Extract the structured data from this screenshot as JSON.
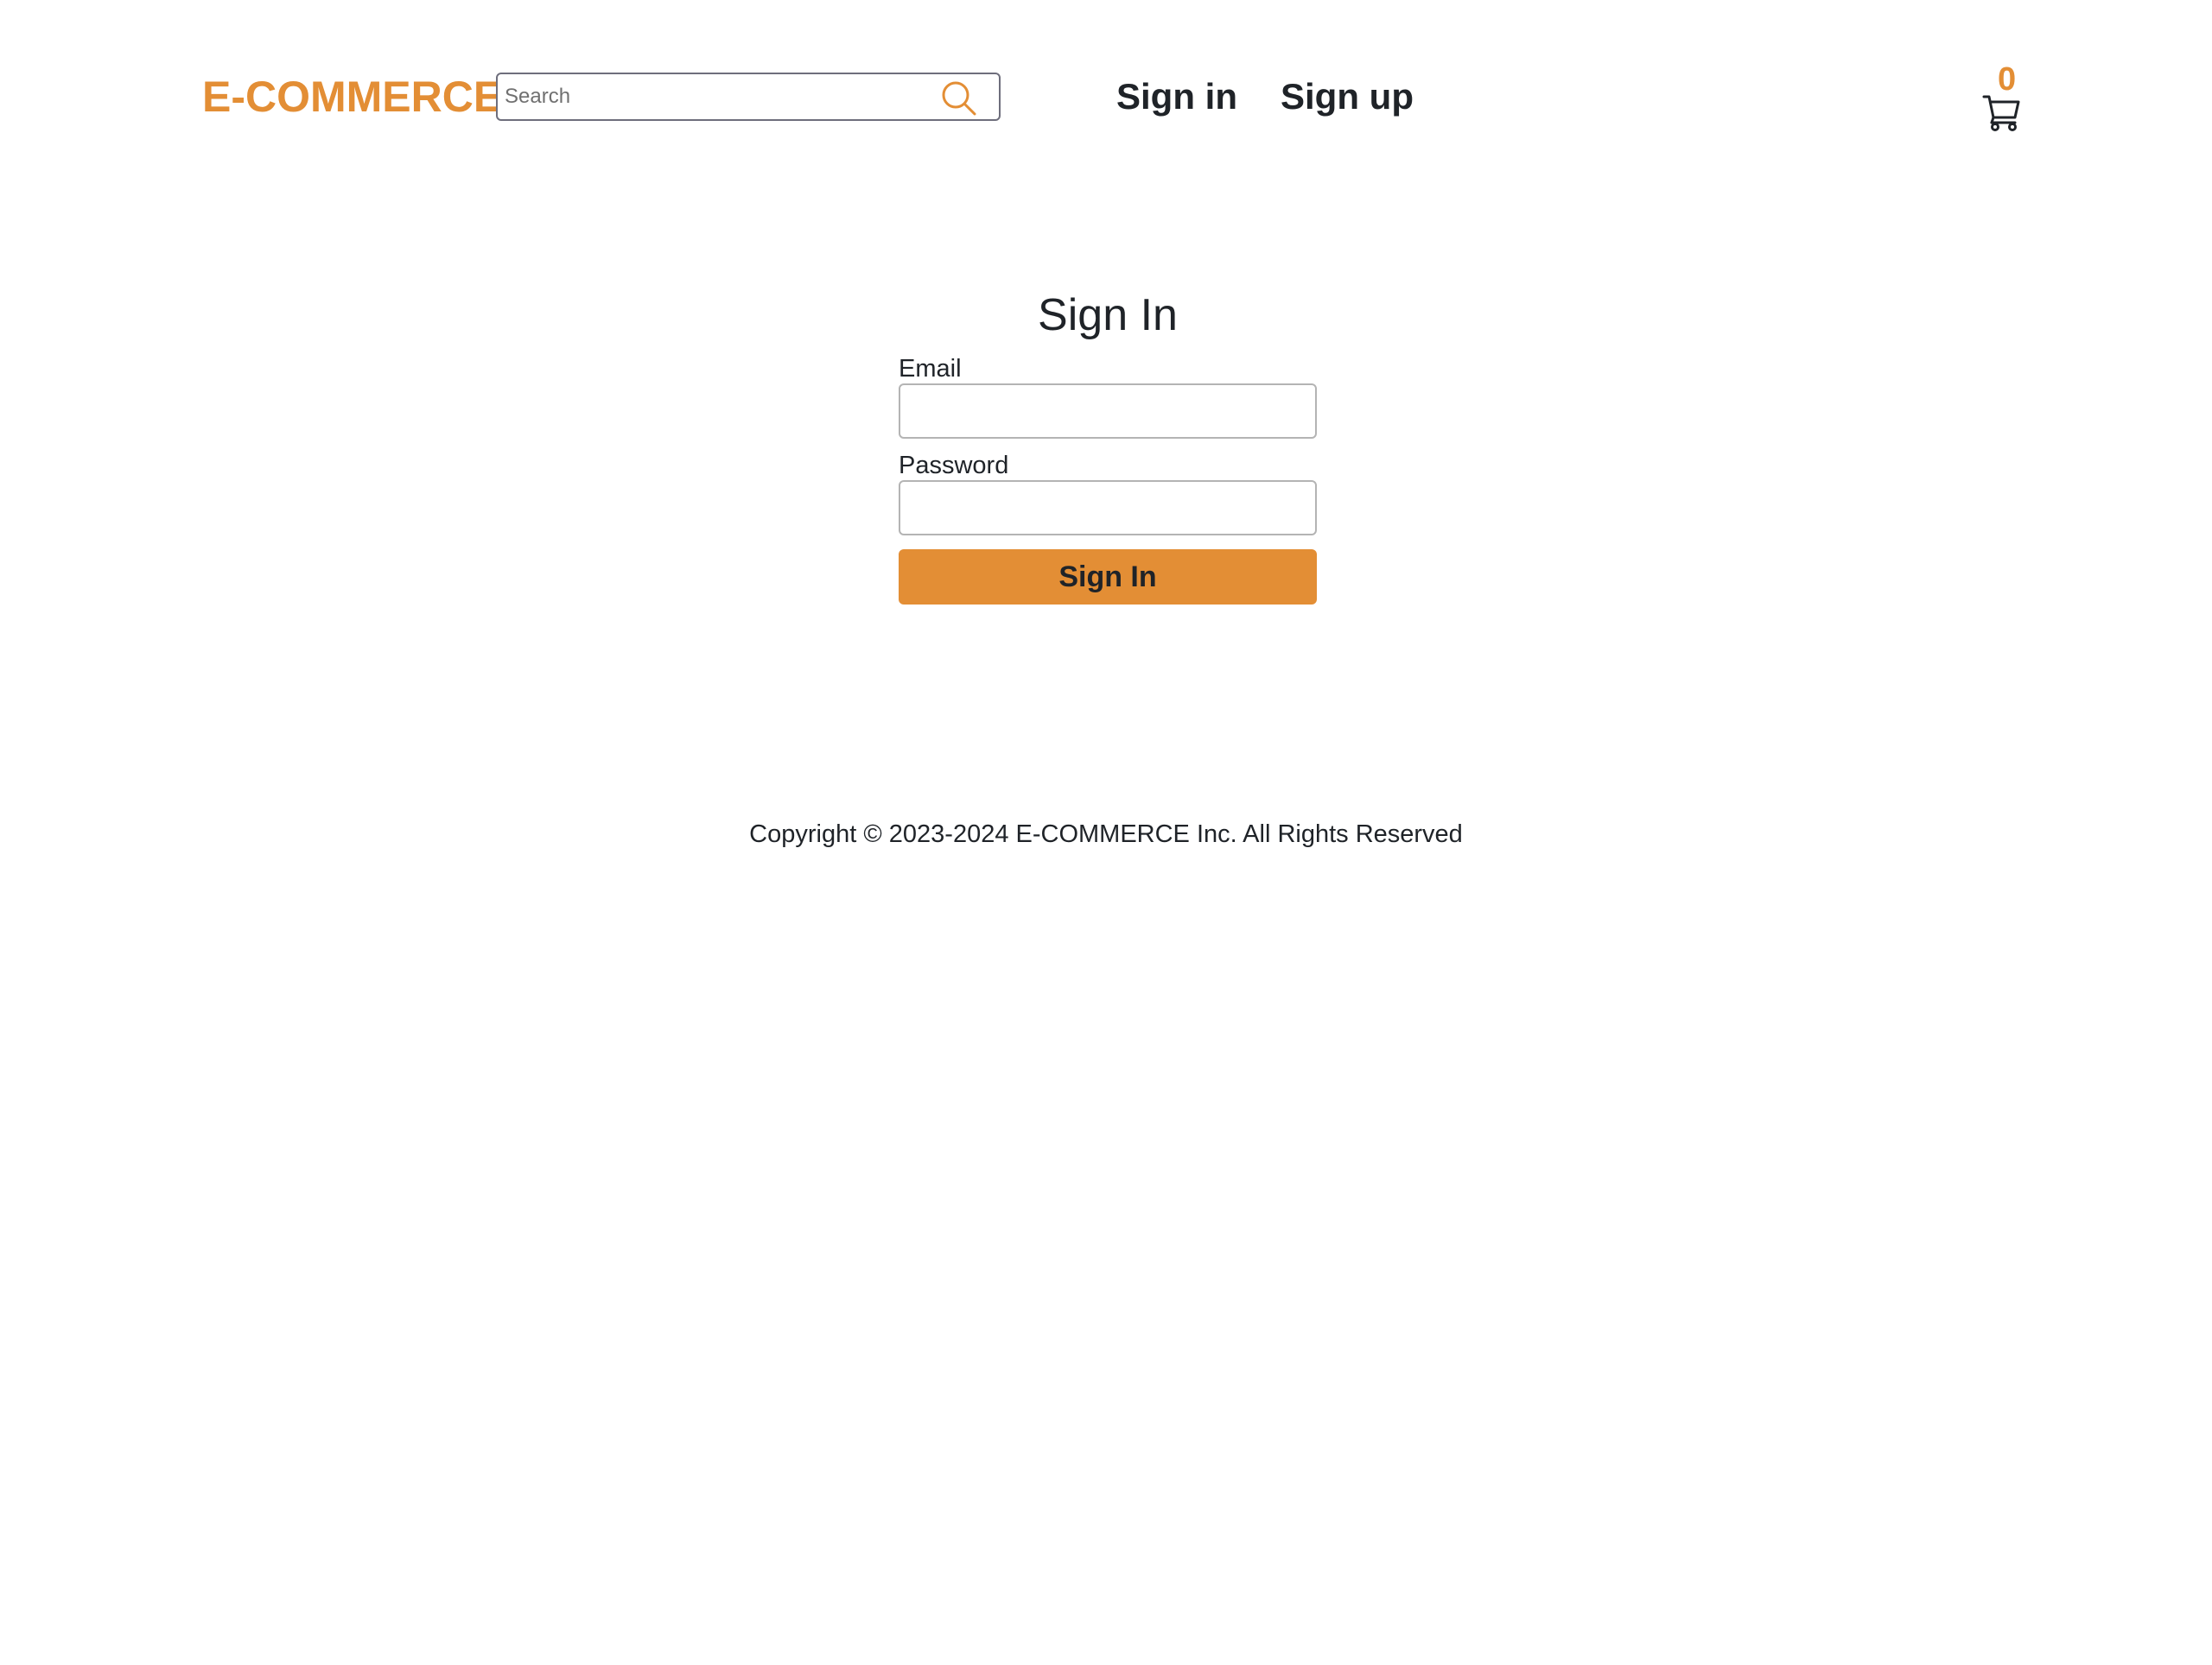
{
  "header": {
    "brand": "E-COMMERCE",
    "search": {
      "placeholder": "Search",
      "value": ""
    },
    "nav": {
      "sign_in": "Sign in",
      "sign_up": "Sign up"
    },
    "cart": {
      "count": "0"
    }
  },
  "form": {
    "title": "Sign In",
    "email_label": "Email",
    "email_value": "",
    "password_label": "Password",
    "password_value": "",
    "submit_label": "Sign In"
  },
  "footer": {
    "copyright": "Copyright © 2023-2024 E-COMMERCE Inc. All Rights Reserved"
  },
  "colors": {
    "accent": "#e38e35",
    "text": "#1f2328",
    "input_border": "#b4b4b4",
    "search_border": "#6e6e7c"
  },
  "icons": {
    "search": "search-icon",
    "cart": "cart-icon"
  }
}
